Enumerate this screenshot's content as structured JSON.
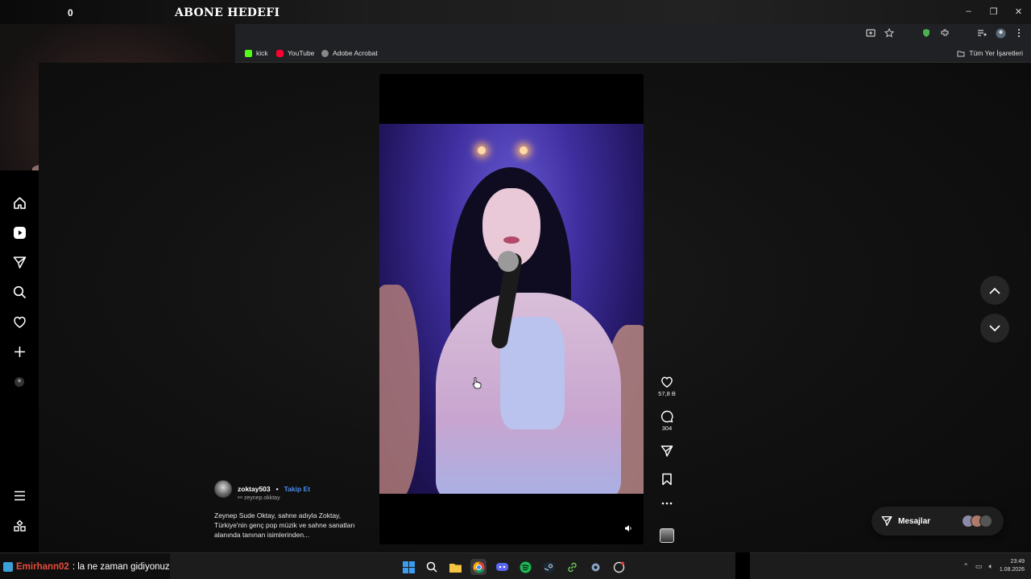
{
  "overlay": {
    "counter": "0",
    "goal_title": "ABONE HEDEFI"
  },
  "window_controls": {
    "minimize": "–",
    "restore": "❐",
    "close": "✕"
  },
  "bookmarks": [
    {
      "label": "kick",
      "color": "#53fc18"
    },
    {
      "label": "YouTube",
      "color": "#ff0033"
    },
    {
      "label": "Adobe Acrobat",
      "color": "#888888"
    }
  ],
  "bookmarks_all": "Tüm Yer İşaretleri",
  "sidebar": {
    "items": [
      {
        "name": "home",
        "icon": "home-icon"
      },
      {
        "name": "reels",
        "icon": "reels-icon"
      },
      {
        "name": "messages",
        "icon": "send-icon"
      },
      {
        "name": "search",
        "icon": "search-icon"
      },
      {
        "name": "notifications",
        "icon": "heart-icon"
      },
      {
        "name": "create",
        "icon": "plus-icon"
      },
      {
        "name": "profile",
        "icon": "profile-icon"
      },
      {
        "name": "more",
        "icon": "menu-icon"
      },
      {
        "name": "also-from-meta",
        "icon": "grid-icon"
      }
    ]
  },
  "post": {
    "username": "zoktay503",
    "separator": "•",
    "follow_label": "Takip Et",
    "sub_user": "zeynep.okktay",
    "description": "Zeynep Sude Oktay, sahne adıyla Zoktay, Türkiye'nin genç pop müzik ve sahne sanatları alanında tanınan isimlerinden..."
  },
  "actions": {
    "likes": "57,8 B",
    "comments": "304"
  },
  "messages_label": "Mesajlar",
  "chat": {
    "user": "Emirhann02",
    "text": ": la ne zaman gidiyonuz"
  },
  "clock": {
    "time": "23:49",
    "date": "1.08.2026"
  },
  "colors": {
    "accent_link": "#4d8ce8",
    "chat_user": "#e64c3c",
    "kick": "#53fc18"
  }
}
